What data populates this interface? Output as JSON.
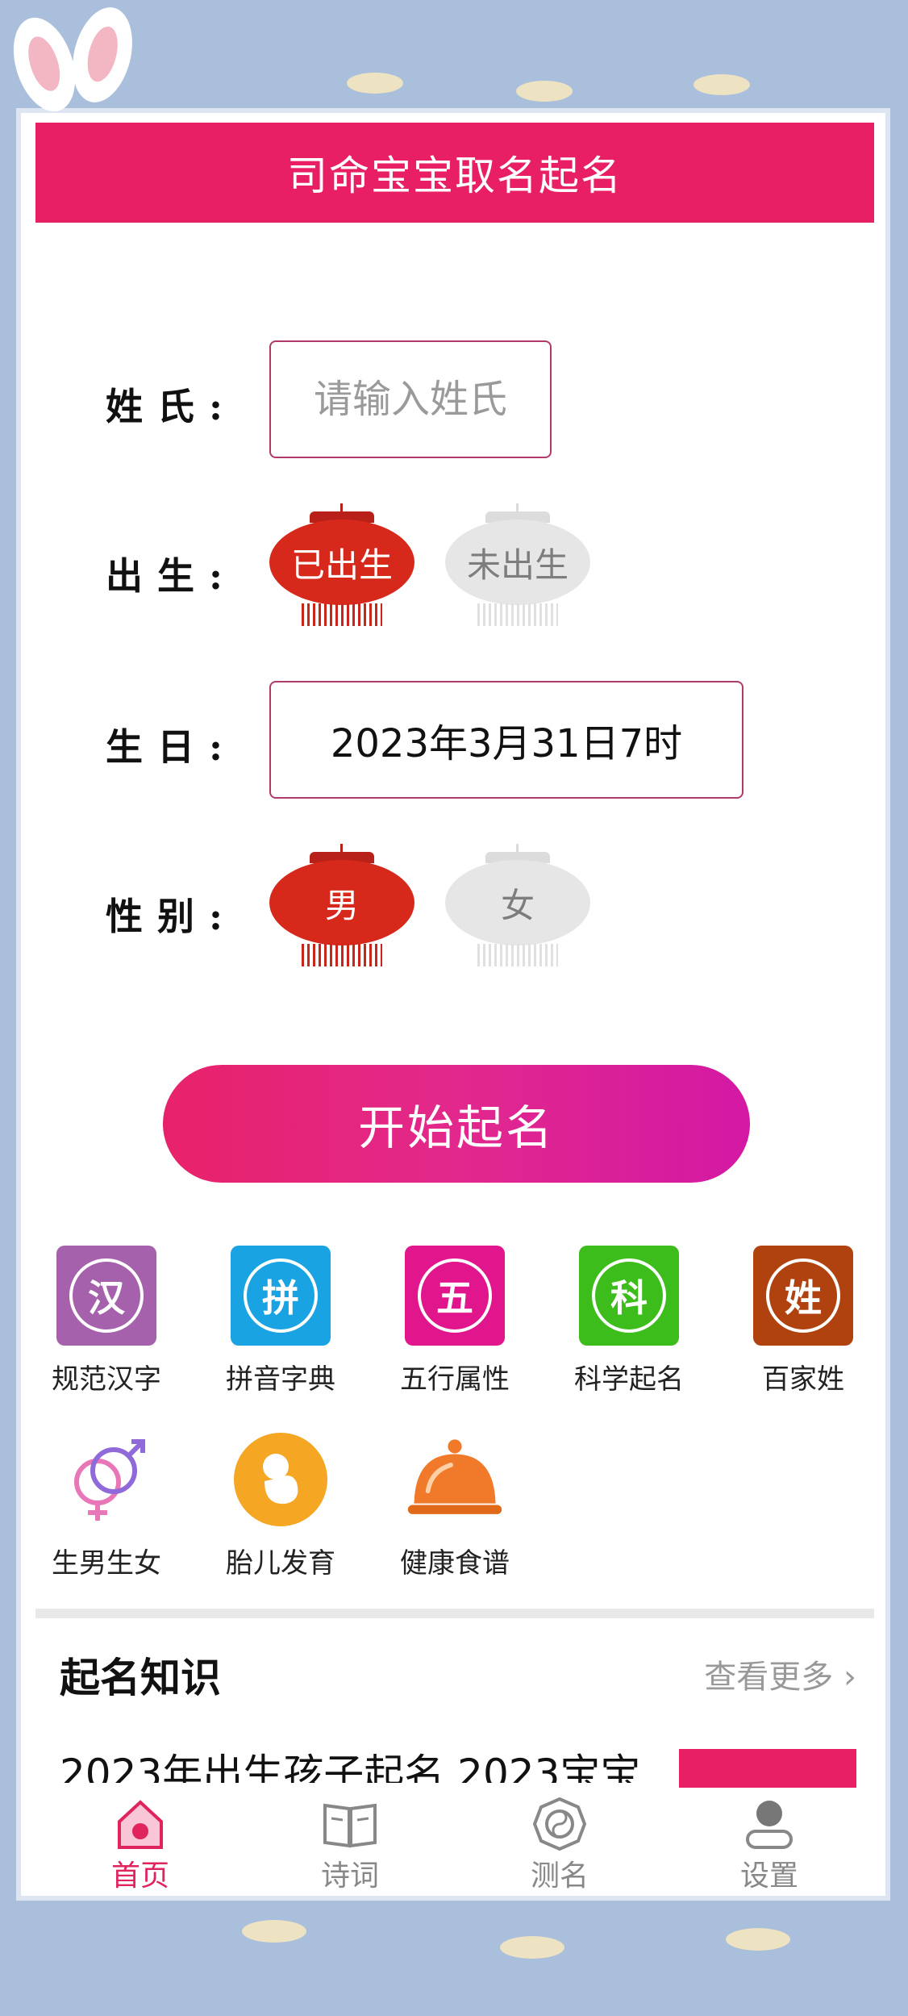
{
  "header": {
    "title": "司命宝宝取名起名"
  },
  "form": {
    "surname_label": "姓氏:",
    "surname_placeholder": "请输入姓氏",
    "birth_label": "出生:",
    "birth_options": [
      "已出生",
      "未出生"
    ],
    "birth_selected": "已出生",
    "birthday_label": "生日:",
    "birthday_value": "2023年3月31日7时",
    "gender_label": "性别:",
    "gender_options": [
      "男",
      "女"
    ],
    "gender_selected": "男"
  },
  "start_button": {
    "label": "开始起名"
  },
  "tools": [
    {
      "glyph": "汉",
      "label": "规范汉字",
      "color": "#a661ad"
    },
    {
      "glyph": "拼",
      "label": "拼音字典",
      "color": "#1aa3e3"
    },
    {
      "glyph": "五",
      "label": "五行属性",
      "color": "#e1158c"
    },
    {
      "glyph": "科",
      "label": "科学起名",
      "color": "#3dbd1b"
    },
    {
      "glyph": "姓",
      "label": "百家姓",
      "color": "#b0420f"
    },
    {
      "icon": "gender-symbol-icon",
      "label": "生男生女"
    },
    {
      "icon": "fetus-icon",
      "label": "胎儿发育"
    },
    {
      "icon": "food-dome-icon",
      "label": "健康食谱"
    }
  ],
  "knowledge": {
    "title": "起名知识",
    "more": "查看更多",
    "article_title": "2023年出生孩子起名 2023宝宝"
  },
  "tabbar": [
    {
      "label": "首页",
      "icon": "home-icon",
      "active": true
    },
    {
      "label": "诗词",
      "icon": "book-icon",
      "active": false
    },
    {
      "label": "测名",
      "icon": "taiji-icon",
      "active": false
    },
    {
      "label": "设置",
      "icon": "user-icon",
      "active": false
    }
  ],
  "colors": {
    "accent": "#e81f64",
    "lantern_red": "#d6291b",
    "background": "#a9bfdb"
  }
}
